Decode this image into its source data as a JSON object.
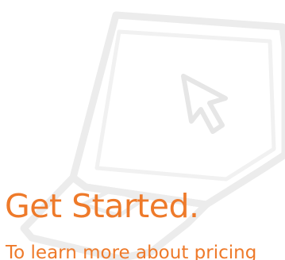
{
  "promo": {
    "headline": "Get Started.",
    "subtext": "To learn more about pricing",
    "illustration_icon": "laptop-cursor-icon",
    "text_color": "#ee7a2a",
    "illustration_color": "#ececec",
    "background_color": "#ffffff"
  }
}
